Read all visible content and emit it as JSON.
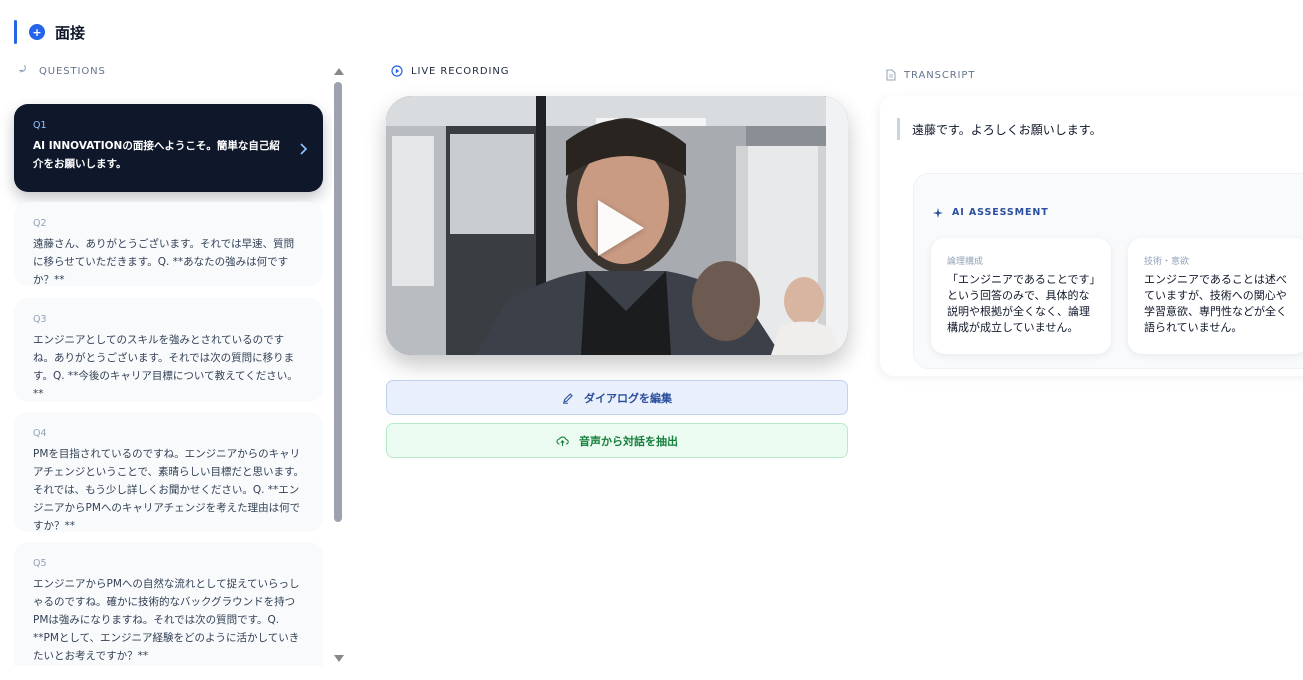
{
  "header": {
    "title": "面接",
    "icon": "plus-circle-icon",
    "accent": "#2563eb"
  },
  "questions": {
    "label": "QUESTIONS",
    "items": [
      {
        "num": "Q1",
        "text": "AI INNOVATIONの面接へようこそ。簡単な自己紹介をお願いします。",
        "active": true
      },
      {
        "num": "Q2",
        "text": "遠藤さん、ありがとうございます。それでは早速、質問に移らせていただきます。Q. **あなたの強みは何ですか？**"
      },
      {
        "num": "Q3",
        "text": "エンジニアとしてのスキルを強みとされているのですね。ありがとうございます。それでは次の質問に移ります。Q. **今後のキャリア目標について教えてください。**"
      },
      {
        "num": "Q4",
        "text": "PMを目指されているのですね。エンジニアからのキャリアチェンジということで、素晴らしい目標だと思います。それでは、もう少し詳しくお聞かせください。Q. **エンジニアからPMへのキャリアチェンジを考えた理由は何ですか？**"
      },
      {
        "num": "Q5",
        "text": "エンジニアからPMへの自然な流れとして捉えていらっしゃるのですね。確かに技術的なバックグラウンドを持つPMは強みになりますね。それでは次の質問です。Q. **PMとして、エンジニア経験をどのように活かしていきたいとお考えですか？**"
      }
    ]
  },
  "live": {
    "label": "LIVE RECORDING"
  },
  "buttons": {
    "edit": "ダイアログを編集",
    "extract": "音声から対話を抽出"
  },
  "transcript": {
    "label": "TRANSCRIPT",
    "line": "遠藤です。よろしくお願いします。",
    "assessment": {
      "label": "AI ASSESSMENT",
      "cards": [
        {
          "title": "論理構成",
          "text": "「エンジニアであることです」という回答のみで、具体的な説明や根拠が全くなく、論理構成が成立していません。"
        },
        {
          "title": "技術・意欲",
          "text": "エンジニアであることは述べていますが、技術への関心や学習意欲、専門性などが全く語られていません。"
        }
      ]
    }
  },
  "colors": {
    "active_card": "#0f172a",
    "edit_button": "#eaf0fb",
    "extract_button": "#ecfbf1"
  }
}
